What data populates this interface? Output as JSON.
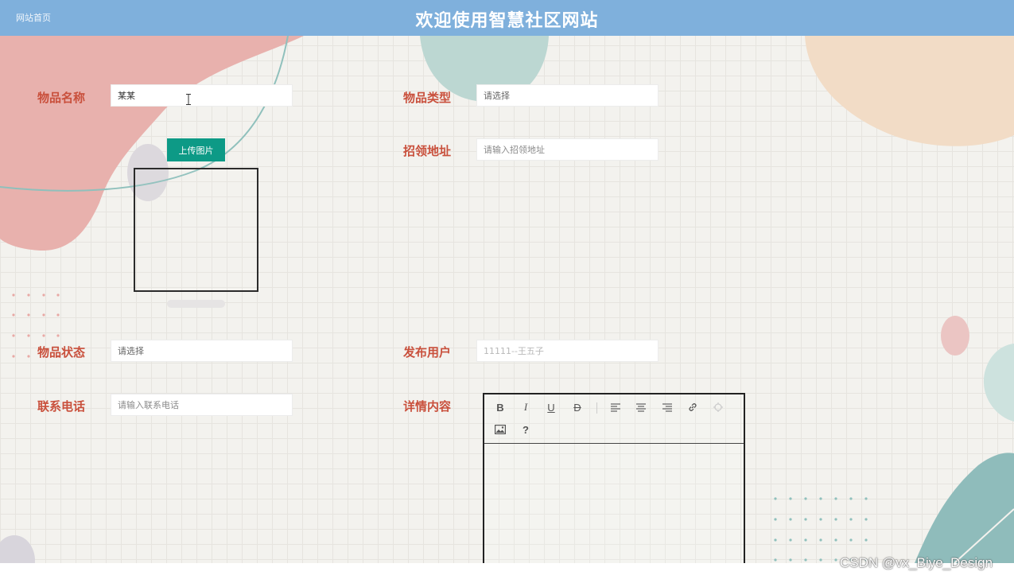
{
  "header": {
    "home_link": "网站首页",
    "title": "欢迎使用智慧社区网站"
  },
  "form": {
    "item_name": {
      "label": "物品名称",
      "value": "某某"
    },
    "item_type": {
      "label": "物品类型",
      "placeholder": "请选择"
    },
    "upload": {
      "button_label": "上传图片"
    },
    "pickup_address": {
      "label": "招领地址",
      "placeholder": "请输入招领地址"
    },
    "item_status": {
      "label": "物品状态",
      "placeholder": "请选择"
    },
    "publisher": {
      "label": "发布用户",
      "value": "11111--王五子"
    },
    "phone": {
      "label": "联系电话",
      "placeholder": "请输入联系电话"
    },
    "details": {
      "label": "详情内容",
      "toolbar": {
        "bold": "B",
        "italic": "I",
        "underline": "U",
        "strike": "D",
        "help": "?"
      }
    }
  },
  "watermark": "CSDN @vx_Biye_Design",
  "colors": {
    "header": "#7fb0dc",
    "label": "#c9503c",
    "upload_button": "#0d9a86"
  },
  "icons": {
    "bold": "bold-icon",
    "italic": "italic-icon",
    "underline": "underline-icon",
    "strike": "strikethrough-icon",
    "align_left": "align-left-icon",
    "align_center": "align-center-icon",
    "align_right": "align-right-icon",
    "link": "link-icon",
    "unlink": "unlink-icon",
    "image": "image-icon",
    "help": "help-icon"
  }
}
